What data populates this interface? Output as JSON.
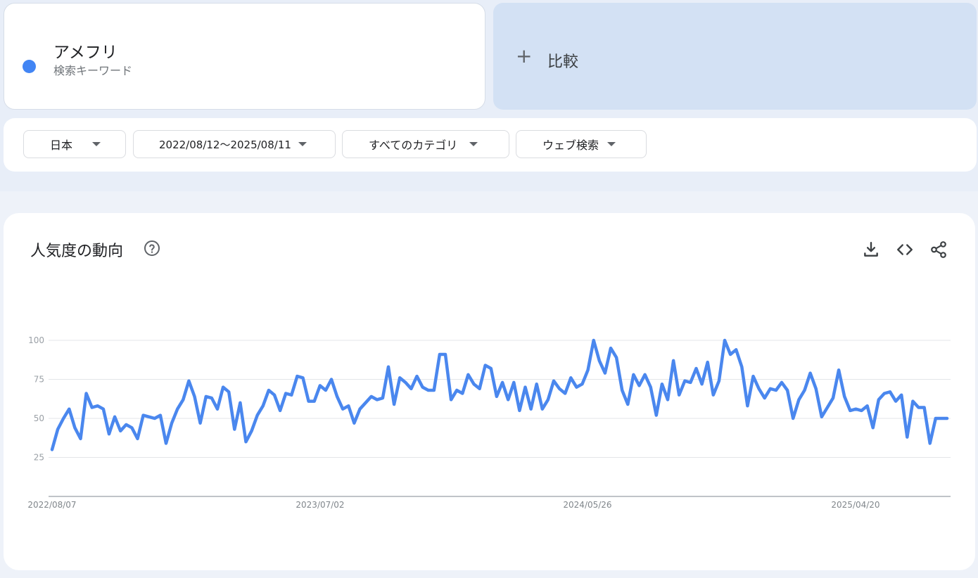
{
  "search_term": {
    "name": "アメフリ",
    "subtitle": "検索キーワード",
    "color": "#4285f4"
  },
  "compare": {
    "plus": "+",
    "label": "比較"
  },
  "filters": {
    "region": "日本",
    "date_range": "2022/08/12〜2025/08/11",
    "category": "すべてのカテゴリ",
    "search_type": "ウェブ検索"
  },
  "chart_section": {
    "title": "人気度の動向",
    "icons": [
      "help-icon",
      "download-icon",
      "embed-code-icon",
      "share-icon"
    ]
  },
  "chart_data": {
    "type": "line",
    "title": "",
    "xlabel": "",
    "ylabel": "",
    "ylim": [
      0,
      100
    ],
    "yticks": [
      25,
      50,
      75,
      100
    ],
    "x_tick_labels": [
      "2022/08/07",
      "2023/07/02",
      "2024/05/26",
      "2025/04/20"
    ],
    "grid": true,
    "color": "#4a87ee",
    "series": [
      {
        "values": [
          30,
          43,
          50,
          56,
          44,
          37,
          66,
          57,
          58,
          56,
          40,
          51,
          42,
          46,
          44,
          37,
          52,
          51,
          50,
          52,
          34,
          47,
          56,
          62,
          74,
          64,
          47,
          64,
          63,
          56,
          70,
          67,
          43,
          60,
          35,
          42,
          52,
          58,
          68,
          65,
          55,
          66,
          65,
          77,
          76,
          61,
          61,
          71,
          68,
          75,
          64,
          56,
          58,
          47,
          56,
          60,
          64,
          62,
          63,
          83,
          59,
          76,
          73,
          69,
          77,
          70,
          68,
          68,
          91,
          91,
          62,
          68,
          66,
          78,
          72,
          69,
          84,
          82,
          64,
          73,
          62,
          73,
          55,
          70,
          56,
          72,
          56,
          62,
          74,
          69,
          66,
          76,
          70,
          72,
          81,
          100,
          87,
          79,
          95,
          89,
          68,
          59,
          78,
          71,
          78,
          70,
          52,
          72,
          62,
          87,
          65,
          74,
          73,
          82,
          72,
          86,
          65,
          74,
          100,
          91,
          94,
          83,
          58,
          77,
          69,
          63,
          69,
          68,
          73,
          68,
          50,
          62,
          68,
          79,
          69,
          51,
          57,
          63,
          81,
          64,
          55,
          56,
          55,
          58,
          44,
          62,
          66,
          67,
          61,
          65,
          38,
          61,
          57,
          57,
          34,
          50,
          50,
          50
        ]
      }
    ]
  }
}
